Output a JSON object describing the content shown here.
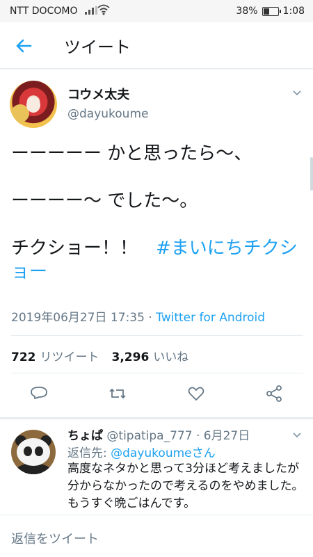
{
  "status_bar": {
    "carrier": "NTT DOCOMO",
    "battery": "38%",
    "time": "1:08",
    "battery_level": 0.38
  },
  "header": {
    "title": "ツイート",
    "back_icon": "back-arrow-icon"
  },
  "tweet": {
    "name": "コウメ太夫",
    "handle": "@dayukoume",
    "lines": [
      "ーーーーー かと思ったら〜、",
      "ーーーー〜 でした〜。"
    ],
    "line3_text": "チクショー！！　",
    "hashtag": "#まいにちチクショー",
    "timestamp": "2019年06月27日 17:35 · ",
    "client": "Twitter for Android",
    "retweets_count": "722",
    "retweets_label": "リツイート",
    "likes_count": "3,296",
    "likes_label": "いいね"
  },
  "reply": {
    "name": "ちょぱ",
    "handle": "@tipatipa_777",
    "date": " · 6月27日",
    "to_label": "返信先: ",
    "to_user": "@dayukoumeさん",
    "text": "高度なネタかと思って3分ほど考えましたが分からなかったので考えるのをやめました。もうすぐ晩ごはんです。"
  },
  "compose": {
    "placeholder": "返信をツイート"
  },
  "colors": {
    "accent": "#1da1f2",
    "text": "#14171a",
    "muted": "#657786",
    "divider": "#e6ecf0"
  }
}
